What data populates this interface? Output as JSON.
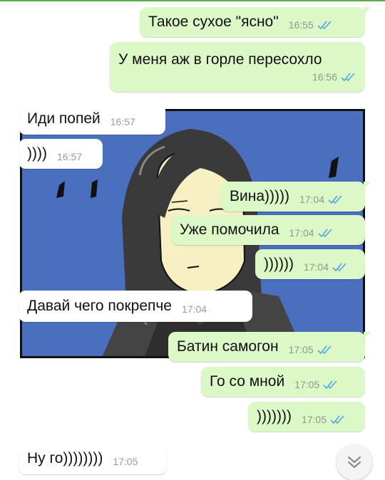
{
  "colors": {
    "outgoing": "#dcf8c6",
    "incoming": "#ffffff",
    "read_check": "#4fa8e0",
    "wallpaper_blue": "#4a6fbf"
  },
  "icons": {
    "read_receipt": "double-check-icon",
    "scroll_down": "double-chevron-down-icon"
  },
  "messages": [
    {
      "dir": "out",
      "text": "Такое сухое \"ясно\"",
      "time": "16:55"
    },
    {
      "dir": "out",
      "text": "У меня аж в горле пересохло",
      "time": "16:56"
    },
    {
      "dir": "in",
      "text": "Иди попей",
      "time": "16:57"
    },
    {
      "dir": "in",
      "text": "))))",
      "time": "16:57"
    },
    {
      "dir": "out",
      "text": "Вина)))))",
      "time": "17:04"
    },
    {
      "dir": "out",
      "text": "Уже помочила",
      "time": "17:04"
    },
    {
      "dir": "out",
      "text": "))))))",
      "time": "17:04"
    },
    {
      "dir": "in",
      "text": "Давай чего покрепче",
      "time": "17:04"
    },
    {
      "dir": "out",
      "text": "Батин самогон",
      "time": "17:05"
    },
    {
      "dir": "out",
      "text": "Го со мной",
      "time": "17:05"
    },
    {
      "dir": "out",
      "text": ")))))))",
      "time": "17:05"
    },
    {
      "dir": "in",
      "text": "Ну го))))))))",
      "time": "17:05"
    }
  ]
}
